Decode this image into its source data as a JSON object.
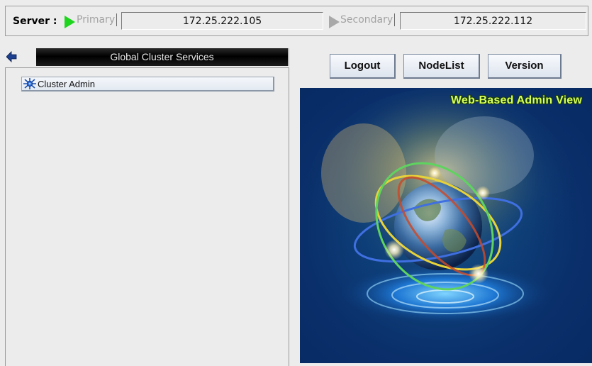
{
  "server_bar": {
    "label": "Server :",
    "primary": {
      "role_label": "Primary",
      "status": "active",
      "status_color": "#1ed51e",
      "ip": "172.25.222.105"
    },
    "secondary": {
      "role_label": "Secondary",
      "status": "inactive",
      "status_color": "#a9a9a9",
      "ip": "172.25.222.112"
    }
  },
  "left_panel": {
    "section_header": "Global Cluster Services",
    "back_icon": "back-arrow-icon",
    "items": [
      {
        "label": "Cluster Admin",
        "icon": "cluster-admin-icon"
      }
    ]
  },
  "toolbar": {
    "logout_label": "Logout",
    "nodelist_label": "NodeList",
    "version_label": "Version"
  },
  "banner": {
    "title": "Web-Based Admin View",
    "title_color": "#d7ff5a"
  }
}
